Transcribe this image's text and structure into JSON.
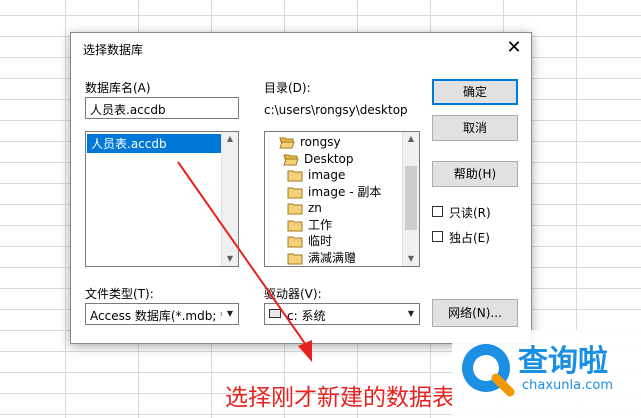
{
  "dialog": {
    "title": "选择数据库",
    "close_glyph": "✕",
    "db_name_label": "数据库名(A)",
    "db_name_value": "人员表.accdb",
    "db_list": [
      "人员表.accdb"
    ],
    "directory_label": "目录(D):",
    "directory_path": "c:\\users\\rongsy\\desktop",
    "tree": [
      {
        "label": "rongsy",
        "open": true
      },
      {
        "label": "Desktop",
        "open": true
      },
      {
        "label": "image",
        "open": false
      },
      {
        "label": "image - 副本",
        "open": false
      },
      {
        "label": "zn",
        "open": false
      },
      {
        "label": "工作",
        "open": false
      },
      {
        "label": "临时",
        "open": false
      },
      {
        "label": "满减满赠",
        "open": false
      }
    ],
    "file_type_label": "文件类型(T):",
    "file_type_value": "Access 数据库(*.mdb; *.",
    "drive_label": "驱动器(V):",
    "drive_value": "c: 系统",
    "buttons": {
      "ok": "确定",
      "cancel": "取消",
      "help": "帮助(H)",
      "network": "网络(N)..."
    },
    "checkboxes": {
      "readonly": "只读(R)",
      "exclusive": "独占(E)"
    }
  },
  "annotation": "选择刚才新建的数据表",
  "watermark": {
    "brand": "查询啦",
    "url": "chaxunla.com"
  },
  "colors": {
    "selection": "#0078d7",
    "annotation": "#e8231f",
    "logo_blue": "#1a8fe3",
    "logo_orange": "#f39800"
  }
}
